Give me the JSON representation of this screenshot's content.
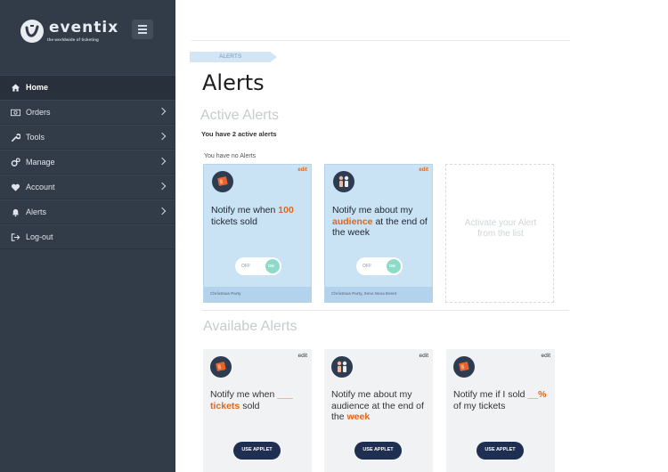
{
  "app": {
    "logo_text": "eventix",
    "tagline": "the worldwide of ticketing"
  },
  "sidebar": {
    "items": [
      {
        "label": "Home",
        "icon": "home-icon",
        "active": true,
        "chevron": false
      },
      {
        "label": "Orders",
        "icon": "money-icon",
        "active": false,
        "chevron": true
      },
      {
        "label": "Tools",
        "icon": "wrench-icon",
        "active": false,
        "chevron": true
      },
      {
        "label": "Manage",
        "icon": "gears-icon",
        "active": false,
        "chevron": true
      },
      {
        "label": "Account",
        "icon": "heart-icon",
        "active": false,
        "chevron": true
      },
      {
        "label": "Alerts",
        "icon": "bell-icon",
        "active": false,
        "chevron": true
      },
      {
        "label": "Log-out",
        "icon": "logout-icon",
        "active": false,
        "chevron": false
      }
    ]
  },
  "breadcrumb": "ALERTS",
  "page_title": "Alerts",
  "active_section": {
    "title": "Active Alerts",
    "count_text": "You have 2 active alerts",
    "empty_text": "You have no Alerts",
    "cards": [
      {
        "edit": "edit",
        "icon": "ticket-icon",
        "msg_pre": "Notify me when ",
        "msg_hl": "100",
        "msg_post": " tickets sold",
        "toggle_off": "OFF",
        "toggle_on": "ON",
        "footer": "Christmas Party"
      },
      {
        "edit": "edit",
        "icon": "people-icon",
        "msg_pre": "Notify me about my ",
        "msg_hl": "audience",
        "msg_post": " at the end of the week",
        "toggle_off": "OFF",
        "toggle_on": "ON",
        "footer": "Christmas Party, Sens Nova Event"
      }
    ],
    "placeholder": "Activate your Alert from the list"
  },
  "available_section": {
    "title": "Availabe Alerts",
    "cards": [
      {
        "edit": "edit",
        "icon": "ticket-icon",
        "msg_pre": "Notify me when ",
        "msg_hl": "___ tickets",
        "msg_post": " sold",
        "button": "USE APPLET"
      },
      {
        "edit": "edit",
        "icon": "people-icon",
        "msg_pre": "Notify me about my audience at the end of the ",
        "msg_hl": "week",
        "msg_post": "",
        "button": "USE APPLET"
      },
      {
        "edit": "edit",
        "icon": "ticket-icon",
        "msg_pre": "Notify me if I sold ",
        "msg_hl": "__%",
        "msg_post": " of my tickets",
        "button": "USE APPLET"
      }
    ]
  },
  "colors": {
    "sidebar_bg": "#323b48",
    "accent_orange": "#e0661b",
    "card_blue": "#c9e2f4",
    "button_navy": "#1e2f52"
  }
}
